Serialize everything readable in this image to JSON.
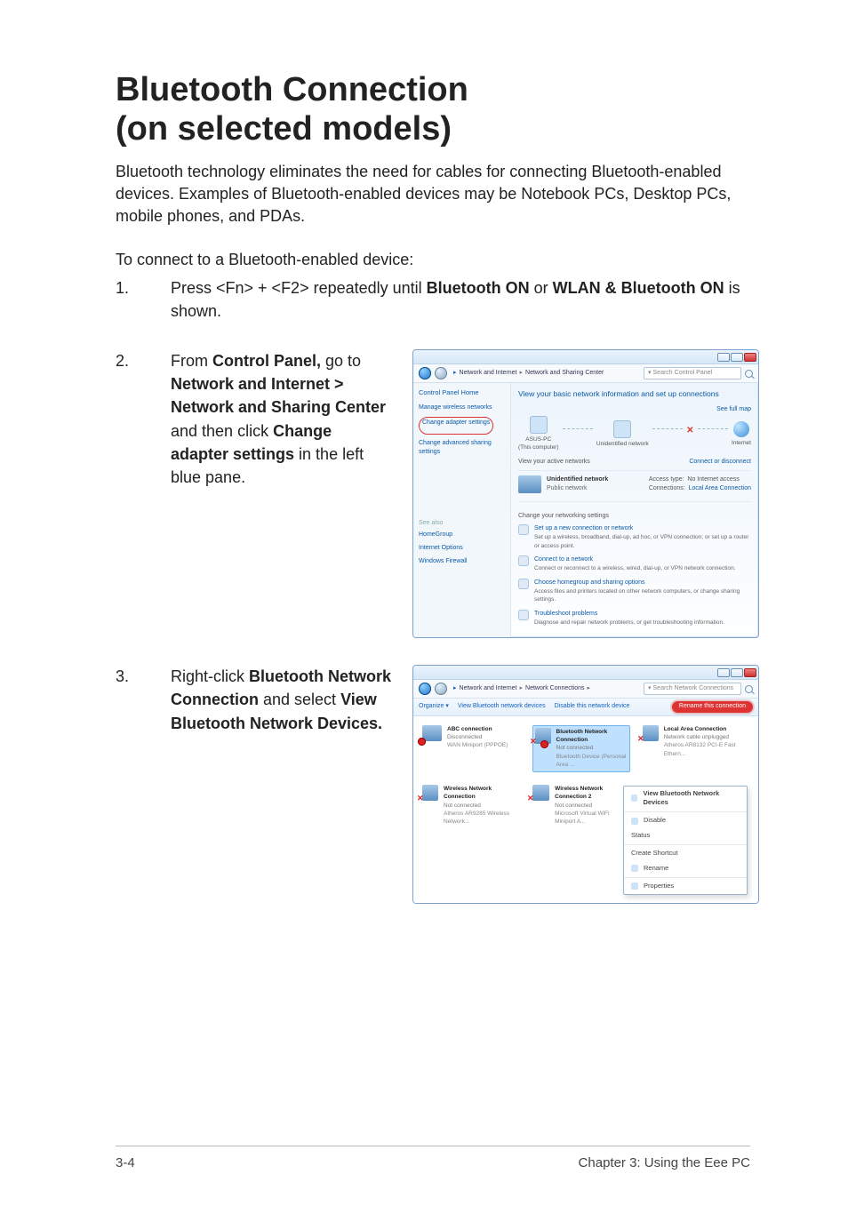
{
  "page": {
    "title_line1": "Bluetooth Connection",
    "title_line2": "(on selected models)",
    "intro": "Bluetooth technology eliminates the need for cables for connecting Bluetooth-enabled devices. Examples of Bluetooth-enabled devices may be Notebook PCs, Desktop PCs, mobile phones, and PDAs.",
    "lead": "To connect to a Bluetooth-enabled device:"
  },
  "steps": {
    "s1_a": "Press <Fn> + <F2> repeatedly until ",
    "s1_b1": "Bluetooth ON",
    "s1_mid": " or ",
    "s1_b2": "WLAN & Bluetooth ON",
    "s1_c": " is shown.",
    "s2_a": "From ",
    "s2_b1": "Control Panel,",
    "s2_a2": " go to ",
    "s2_b2": "Network and Internet > Network and Sharing Center",
    "s2_a3": " and then click ",
    "s2_b3": "Change adapter settings",
    "s2_a4": " in the left blue pane.",
    "s3_a": "Right-click ",
    "s3_b1": "Bluetooth Network Connection",
    "s3_a2": " and select ",
    "s3_b2": "View Bluetooth Network Devices."
  },
  "win1": {
    "breadcrumb_a": "Network and Internet",
    "breadcrumb_b": "Network and Sharing Center",
    "search_placeholder": "Search Control Panel",
    "side": {
      "home": "Control Panel Home",
      "l1": "Manage wireless networks",
      "l2": "Change adapter settings",
      "l3": "Change advanced sharing settings",
      "see_title": "See also",
      "see_a": "HomeGroup",
      "see_b": "Internet Options",
      "see_c": "Windows Firewall"
    },
    "main": {
      "head": "View your basic network information and set up connections",
      "full_map": "See full map",
      "node_a": "ASUS-PC",
      "node_a_sub": "(This computer)",
      "node_b": "Unidentified network",
      "node_c": "Internet",
      "active_label": "View your active networks",
      "conn_disc": "Connect or disconnect",
      "net_title": "Unidentified network",
      "net_sub": "Public network",
      "access_type_k": "Access type:",
      "access_type_v": "No Internet access",
      "conns_k": "Connections:",
      "conns_v": "Local Area Connection",
      "change_head": "Change your networking settings",
      "opt1_t": "Set up a new connection or network",
      "opt1_d": "Set up a wireless, broadband, dial-up, ad hoc, or VPN connection; or set up a router or access point.",
      "opt2_t": "Connect to a network",
      "opt2_d": "Connect or reconnect to a wireless, wired, dial-up, or VPN network connection.",
      "opt3_t": "Choose homegroup and sharing options",
      "opt3_d": "Access files and printers located on other network computers, or change sharing settings.",
      "opt4_t": "Troubleshoot problems",
      "opt4_d": "Diagnose and repair network problems, or get troubleshooting information."
    }
  },
  "win2": {
    "breadcrumb_a": "Network and Internet",
    "breadcrumb_b": "Network Connections",
    "search_placeholder": "Search Network Connections",
    "toolbar": {
      "organize": "Organize ▾",
      "view": "View Bluetooth network devices",
      "disable": "Disable this network device",
      "rename_tag": "Rename this connection"
    },
    "icons": {
      "a_t": "ABC connection",
      "a_s": "Disconnected",
      "a_d": "WAN Miniport (PPPOE)",
      "b_t": "Bluetooth Network Connection",
      "b_s": "Not connected",
      "b_d": "Bluetooth Device (Personal Area ...",
      "c_t": "Local Area Connection",
      "c_s": "Network cable unplugged",
      "c_d": "Atheros AR8132 PCI-E Fast Ethern...",
      "d_t": "Wireless Network Connection",
      "d_s": "Not connected",
      "d_d": "Atheros AR9285 Wireless Network...",
      "e_t": "Wireless Network Connection 2",
      "e_s": "Not connected",
      "e_d": "Microsoft Virtual WiFi Miniport A..."
    },
    "menu": {
      "m1": "View Bluetooth Network Devices",
      "m2": "Disable",
      "m3": "Status",
      "m4": "Create Shortcut",
      "m5": "Rename",
      "m6": "Properties"
    }
  },
  "footer": {
    "left": "3-4",
    "right": "Chapter 3:  Using the Eee PC"
  }
}
